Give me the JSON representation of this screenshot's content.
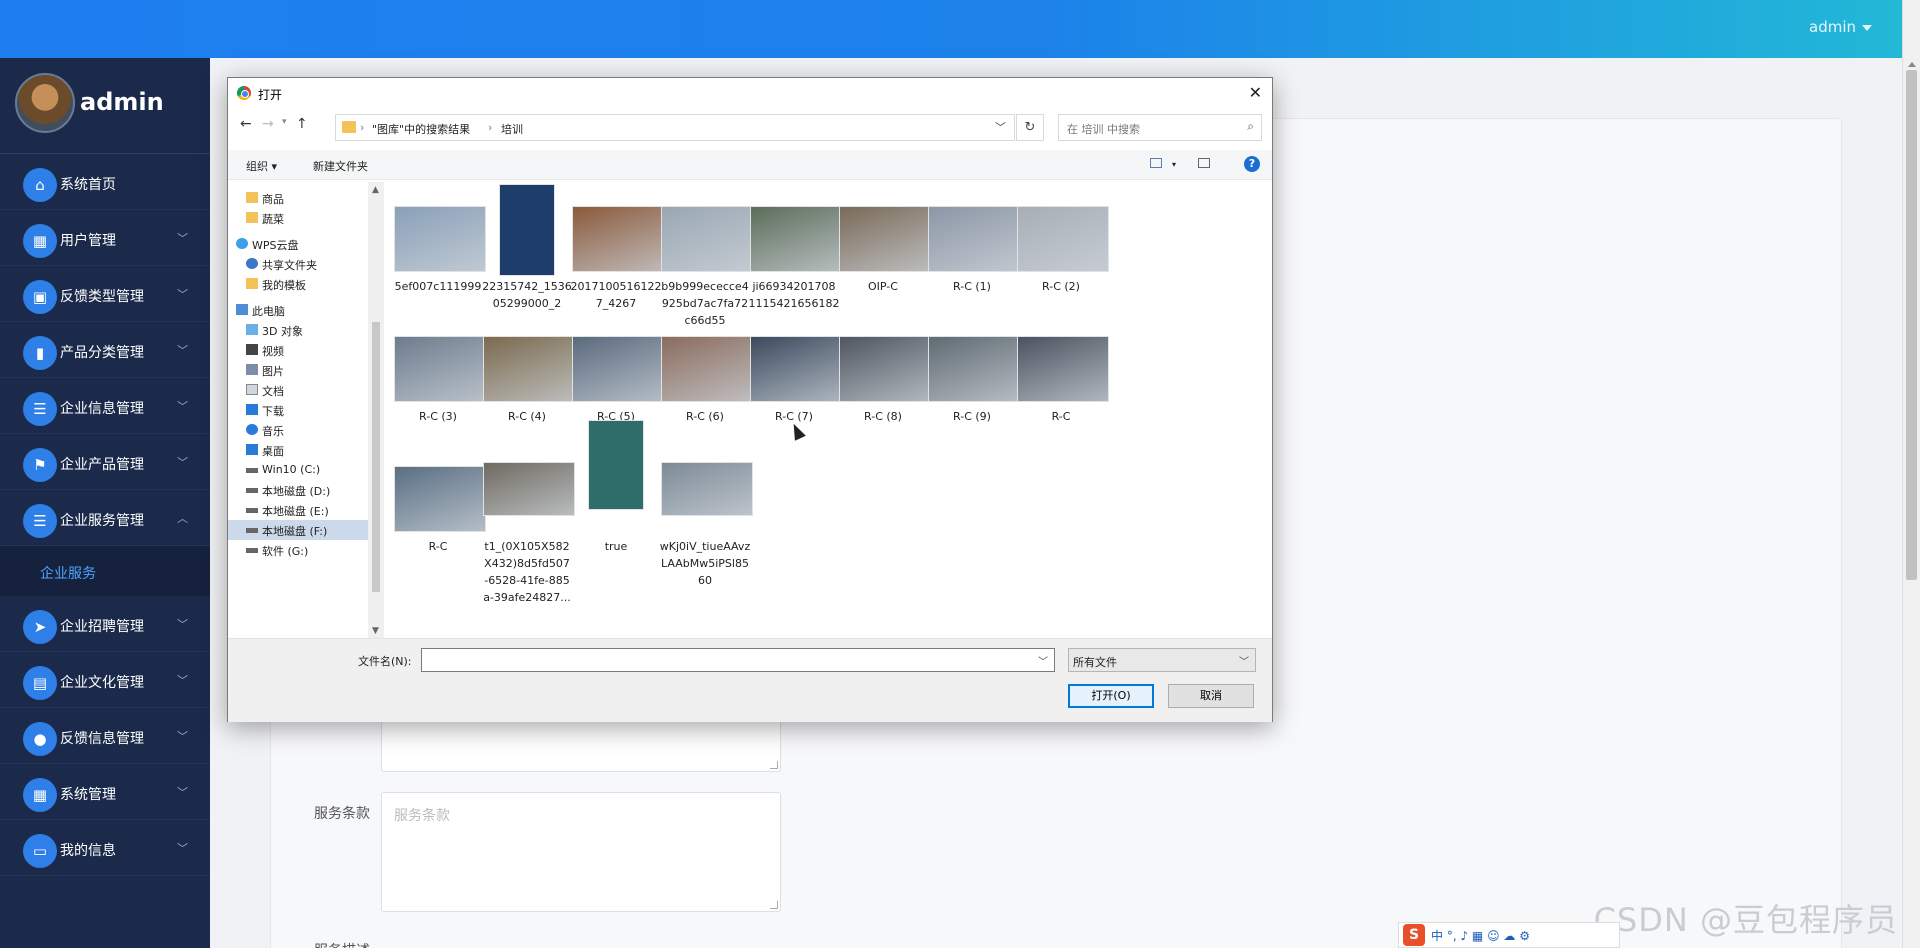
{
  "header": {
    "user": "admin"
  },
  "sidebar": {
    "profile_name": "admin",
    "items": [
      {
        "label": "系统首页",
        "icon": "home-icon",
        "glyph": "⌂",
        "arrow": ""
      },
      {
        "label": "用户管理",
        "icon": "grid-icon",
        "glyph": "▦",
        "arrow": "﹀"
      },
      {
        "label": "反馈类型管理",
        "icon": "doc-x-icon",
        "glyph": "▣",
        "arrow": "﹀"
      },
      {
        "label": "产品分类管理",
        "icon": "bookmark-icon",
        "glyph": "▮",
        "arrow": "﹀"
      },
      {
        "label": "企业信息管理",
        "icon": "list-icon",
        "glyph": "☰",
        "arrow": "﹀"
      },
      {
        "label": "企业产品管理",
        "icon": "flag-icon",
        "glyph": "⚑",
        "arrow": "﹀"
      },
      {
        "label": "企业服务管理",
        "icon": "list-icon",
        "glyph": "☰",
        "arrow": "︿"
      },
      {
        "label": "企业招聘管理",
        "icon": "send-icon",
        "glyph": "➤",
        "arrow": "﹀"
      },
      {
        "label": "企业文化管理",
        "icon": "clipboard-icon",
        "glyph": "▤",
        "arrow": "﹀"
      },
      {
        "label": "反馈信息管理",
        "icon": "user-icon",
        "glyph": "●",
        "arrow": "﹀"
      },
      {
        "label": "系统管理",
        "icon": "grid-icon",
        "glyph": "▦",
        "arrow": "﹀"
      },
      {
        "label": "我的信息",
        "icon": "card-icon",
        "glyph": "▭",
        "arrow": "﹀"
      }
    ],
    "submenu_label": "企业服务"
  },
  "form": {
    "service_terms_label": "服务条款",
    "service_terms_placeholder": "服务条款",
    "next_label": "服务描述"
  },
  "dialog": {
    "title": "打开",
    "close": "✕",
    "breadcrumb": [
      "\"图库\"中的搜索结果",
      "培训"
    ],
    "search_placeholder": "在 培训 中搜索",
    "toolbar": {
      "organize": "组织 ▾",
      "new_folder": "新建文件夹",
      "help": "?"
    },
    "tree": [
      {
        "label": "商品",
        "kind": "folder"
      },
      {
        "label": "蔬菜",
        "kind": "folder"
      },
      {
        "label": "WPS云盘",
        "kind": "cloud"
      },
      {
        "label": "共享文件夹",
        "kind": "share"
      },
      {
        "label": "我的模板",
        "kind": "folder"
      },
      {
        "label": "此电脑",
        "kind": "pc"
      },
      {
        "label": "3D 对象",
        "kind": "3d"
      },
      {
        "label": "视频",
        "kind": "video"
      },
      {
        "label": "图片",
        "kind": "pic"
      },
      {
        "label": "文档",
        "kind": "doc"
      },
      {
        "label": "下载",
        "kind": "down"
      },
      {
        "label": "音乐",
        "kind": "music"
      },
      {
        "label": "桌面",
        "kind": "desk"
      },
      {
        "label": "Win10 (C:)",
        "kind": "drive"
      },
      {
        "label": "本地磁盘 (D:)",
        "kind": "drive"
      },
      {
        "label": "本地磁盘 (E:)",
        "kind": "drive"
      },
      {
        "label": "本地磁盘 (F:)",
        "kind": "drive",
        "selected": true
      },
      {
        "label": "软件 (G:)",
        "kind": "drive"
      }
    ],
    "files": [
      {
        "name": "5ef007c111999",
        "lines": [
          "5ef007c111999"
        ],
        "color": "#8aa0b8"
      },
      {
        "name": "22315742_153605299000_2",
        "lines": [
          "22315742_1536",
          "05299000_2"
        ],
        "color": "#1f3d6b",
        "tall": true
      },
      {
        "name": "20171005161227_4267",
        "lines": [
          "2017100516122",
          "7_4267"
        ],
        "color": "#8a5a3c"
      },
      {
        "name": "b9b999ececce4925bd7ac7fa72c66d55",
        "lines": [
          "b9b999ececce4",
          "925bd7ac7fa72",
          "c66d55"
        ],
        "color": "#9aa7b3"
      },
      {
        "name": "ji6693420170811115421656182",
        "lines": [
          "ji66934201708",
          "1115421656182"
        ],
        "color": "#5c6d5a"
      },
      {
        "name": "OIP-C",
        "lines": [
          "OIP-C"
        ],
        "color": "#7a6a58"
      },
      {
        "name": "R-C (1)",
        "lines": [
          "R-C (1)"
        ],
        "color": "#8c97a6"
      },
      {
        "name": "R-C (2)",
        "lines": [
          "R-C (2)"
        ],
        "color": "#a8aeb6"
      },
      {
        "name": "R-C (3)",
        "lines": [
          "R-C (3)"
        ],
        "color": "#6d7c8e"
      },
      {
        "name": "R-C (4)",
        "lines": [
          "R-C (4)"
        ],
        "color": "#7b6a4e"
      },
      {
        "name": "R-C (5)",
        "lines": [
          "R-C (5)"
        ],
        "color": "#5a6a7e"
      },
      {
        "name": "R-C (6)",
        "lines": [
          "R-C (6)"
        ],
        "color": "#8a6c5e"
      },
      {
        "name": "R-C (7)",
        "lines": [
          "R-C (7)"
        ],
        "color": "#3b4a5e"
      },
      {
        "name": "R-C (8)",
        "lines": [
          "R-C (8)"
        ],
        "color": "#4f5660"
      },
      {
        "name": "R-C (9)",
        "lines": [
          "R-C (9)"
        ],
        "color": "#5f6a72"
      },
      {
        "name": "R-C",
        "lines": [
          "R-C"
        ],
        "color": "#4a5360"
      },
      {
        "name": "R-C",
        "lines": [
          "R-C"
        ],
        "color": "#5a6f84"
      },
      {
        "name": "t1_(0X105X582X432)8d5fd507-6528-41fe-885a-39afe24827...",
        "lines": [
          "t1_(0X105X582",
          "X432)8d5fd507",
          "-6528-41fe-885",
          "a-39afe24827..."
        ],
        "color": "#6e6a60"
      },
      {
        "name": "true",
        "lines": [
          "true"
        ],
        "color": "#2f6d6a",
        "tall": true
      },
      {
        "name": "wKj0iV_tiueAAvzLAAbMw5iPSl8560",
        "lines": [
          "wKj0iV_tiueAAvz",
          "LAAbMw5iPSl85",
          "60"
        ],
        "color": "#7d8a96"
      }
    ],
    "filename_label": "文件名(N):",
    "filename_value": "",
    "filetype_value": "所有文件",
    "open_button": "打开(O)",
    "cancel_button": "取消"
  },
  "watermark": "CSDN @豆包程序员",
  "ime": {
    "logo": "S",
    "mode": "中 °, ♪ ▦ ☺ ☁ ⚙"
  }
}
